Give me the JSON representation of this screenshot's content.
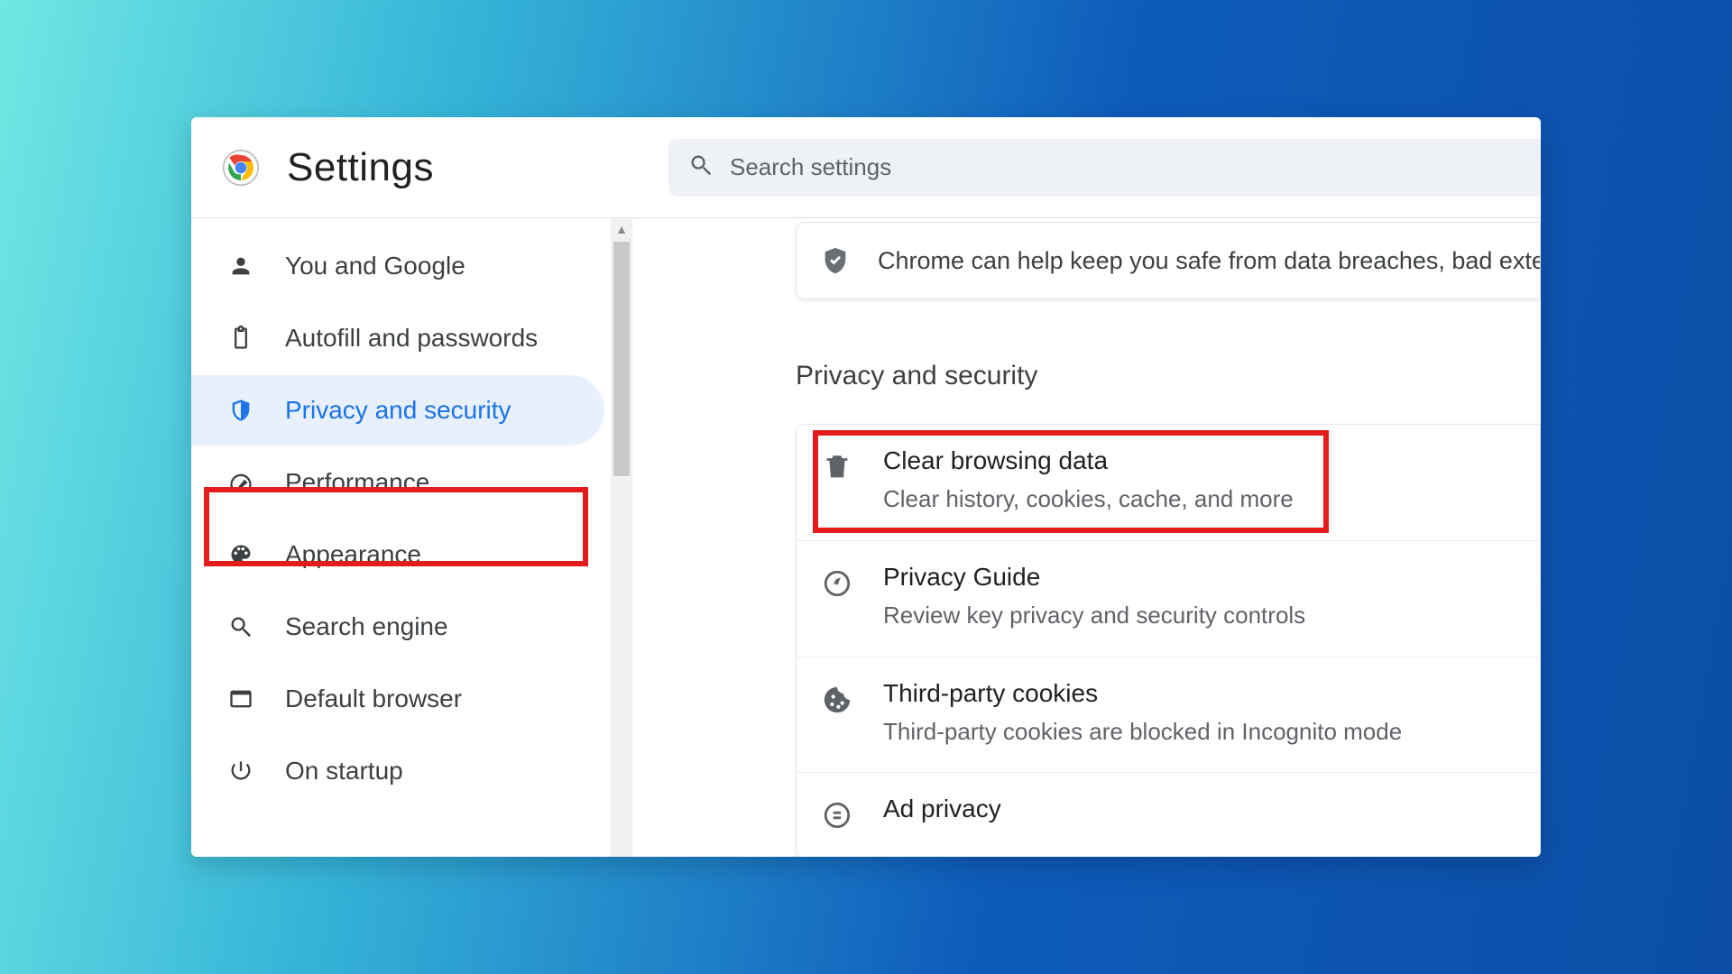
{
  "header": {
    "title": "Settings",
    "search_placeholder": "Search settings"
  },
  "sidebar": {
    "items": [
      {
        "id": "you-and-google",
        "label": "You and Google"
      },
      {
        "id": "autofill-passwords",
        "label": "Autofill and passwords"
      },
      {
        "id": "privacy-security",
        "label": "Privacy and security"
      },
      {
        "id": "performance",
        "label": "Performance"
      },
      {
        "id": "appearance",
        "label": "Appearance"
      },
      {
        "id": "search-engine",
        "label": "Search engine"
      },
      {
        "id": "default-browser",
        "label": "Default browser"
      },
      {
        "id": "on-startup",
        "label": "On startup"
      }
    ],
    "active_index": 2
  },
  "main": {
    "banner_text": "Chrome can help keep you safe from data breaches, bad extensions, and more",
    "section_title": "Privacy and security",
    "cards": [
      {
        "id": "clear-browsing-data",
        "title": "Clear browsing data",
        "subtitle": "Clear history, cookies, cache, and more"
      },
      {
        "id": "privacy-guide",
        "title": "Privacy Guide",
        "subtitle": "Review key privacy and security controls"
      },
      {
        "id": "third-party-cookies",
        "title": "Third-party cookies",
        "subtitle": "Third-party cookies are blocked in Incognito mode"
      },
      {
        "id": "ad-privacy",
        "title": "Ad privacy",
        "subtitle": ""
      }
    ],
    "highlighted_card_index": 0
  }
}
